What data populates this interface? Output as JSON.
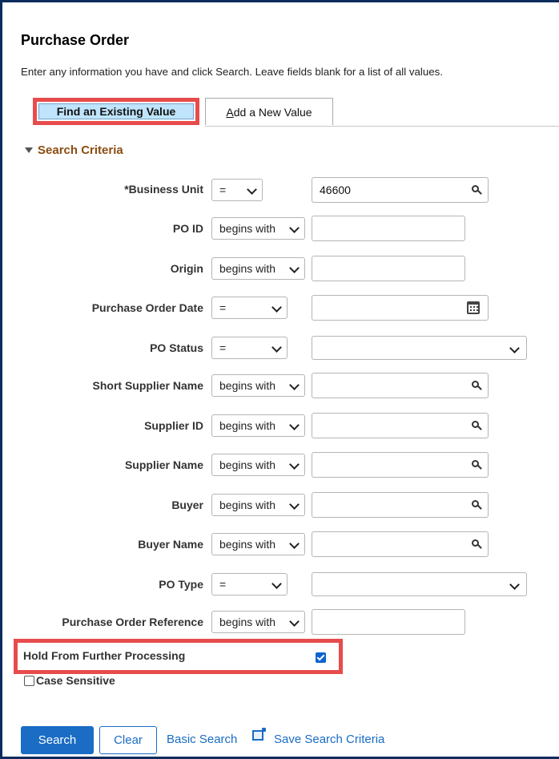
{
  "page": {
    "title": "Purchase Order",
    "instructions": "Enter any information you have and click Search. Leave fields blank for a list of all values."
  },
  "tabs": [
    {
      "label": "Find an Existing Value",
      "active": true
    },
    {
      "label_first": "A",
      "label_rest": "dd a New Value",
      "active": false
    }
  ],
  "section": {
    "label": "Search Criteria"
  },
  "fields": {
    "business_unit": {
      "label": "*Business Unit",
      "operator": "=",
      "value": "46600"
    },
    "po_id": {
      "label": "PO ID",
      "operator": "begins with",
      "value": ""
    },
    "origin": {
      "label": "Origin",
      "operator": "begins with",
      "value": ""
    },
    "po_date": {
      "label": "Purchase Order Date",
      "operator": "=",
      "value": ""
    },
    "po_status": {
      "label": "PO Status",
      "operator": "=",
      "value": ""
    },
    "short_supplier_name": {
      "label": "Short Supplier Name",
      "operator": "begins with",
      "value": ""
    },
    "supplier_id": {
      "label": "Supplier ID",
      "operator": "begins with",
      "value": ""
    },
    "supplier_name": {
      "label": "Supplier Name",
      "operator": "begins with",
      "value": ""
    },
    "buyer": {
      "label": "Buyer",
      "operator": "begins with",
      "value": ""
    },
    "buyer_name": {
      "label": "Buyer Name",
      "operator": "begins with",
      "value": ""
    },
    "po_type": {
      "label": "PO Type",
      "operator": "=",
      "value": ""
    },
    "po_reference": {
      "label": "Purchase Order Reference",
      "operator": "begins with",
      "value": ""
    }
  },
  "hold": {
    "label": "Hold From Further Processing",
    "checked": true
  },
  "case_sensitive": {
    "label": "Case Sensitive",
    "checked": false
  },
  "actions": {
    "search": "Search",
    "clear": "Clear",
    "basic_search": "Basic Search",
    "save_search": "Save Search Criteria"
  },
  "icons": {
    "lookup": "magnifier-icon",
    "calendar": "calendar-icon",
    "save": "save-search-icon",
    "collapse": "triangle-down-icon"
  },
  "colors": {
    "highlight_border": "#e74c4c",
    "active_tab": "#bfe4fb",
    "section_header": "#8b4d11",
    "primary": "#1a6cc4",
    "frame": "#0d2c5e"
  }
}
